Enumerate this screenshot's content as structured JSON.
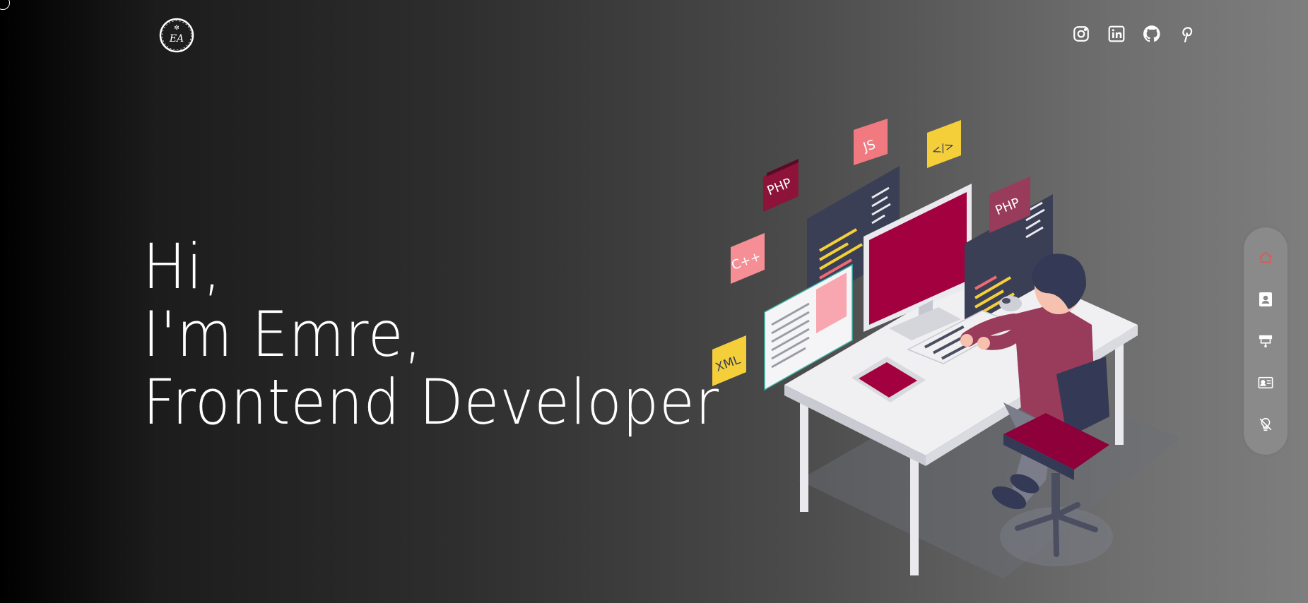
{
  "brand": {
    "logo_text": "EA",
    "logo_icon": "brand-logo"
  },
  "socials": [
    {
      "name": "instagram-icon"
    },
    {
      "name": "linkedin-icon"
    },
    {
      "name": "github-icon"
    },
    {
      "name": "pinterest-icon"
    }
  ],
  "hero": {
    "line1": "Hi,",
    "line2": "I'm Emre,",
    "line3": "Frontend Developer"
  },
  "illustration": {
    "badges": [
      "JS",
      "PHP",
      "C++",
      "XML",
      "PHP",
      "</>"
    ]
  },
  "sidenav": {
    "active_color": "#e0574f",
    "items": [
      {
        "name": "home-icon",
        "active": true
      },
      {
        "name": "about-icon",
        "active": false
      },
      {
        "name": "projects-icon",
        "active": false
      },
      {
        "name": "contact-card-icon",
        "active": false
      },
      {
        "name": "theme-toggle-icon",
        "active": false
      }
    ]
  }
}
